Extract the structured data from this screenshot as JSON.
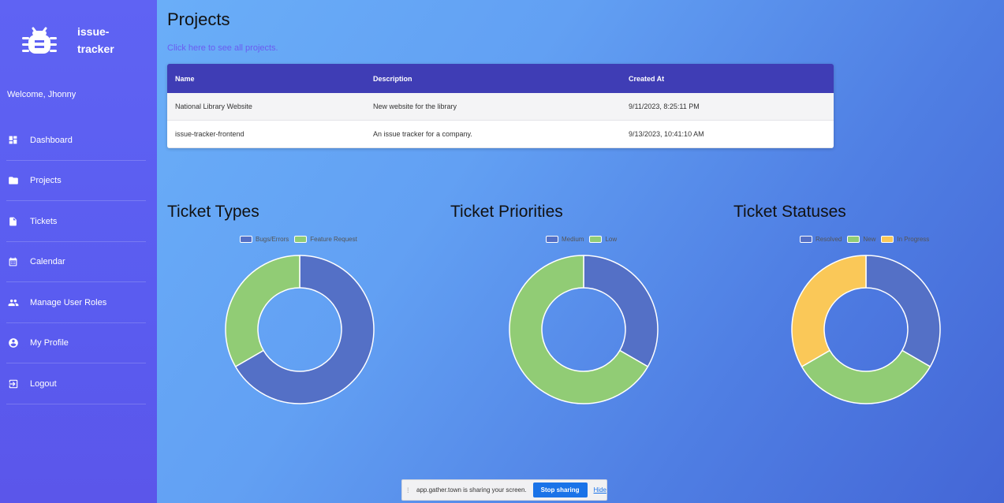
{
  "app": {
    "name": "issue-tracker",
    "name_line1": "issue-",
    "name_line2": "tracker"
  },
  "sidebar": {
    "welcome": "Welcome, Jhonny",
    "items": [
      {
        "label": "Dashboard",
        "icon": "dashboard-icon"
      },
      {
        "label": "Projects",
        "icon": "folder-icon"
      },
      {
        "label": "Tickets",
        "icon": "file-icon"
      },
      {
        "label": "Calendar",
        "icon": "calendar-icon"
      },
      {
        "label": "Manage User Roles",
        "icon": "group-icon"
      },
      {
        "label": "My Profile",
        "icon": "account-circle-icon"
      },
      {
        "label": "Logout",
        "icon": "logout-icon"
      }
    ]
  },
  "main": {
    "title": "Projects",
    "see_all_link": "Click here to see all projects.",
    "table": {
      "headers": [
        "Name",
        "Description",
        "Created At"
      ],
      "rows": [
        [
          "National Library Website",
          "New website for the library",
          "9/11/2023, 8:25:11 PM"
        ],
        [
          "issue-tracker-frontend",
          "An issue tracker for a company.",
          "9/13/2023, 10:41:10 AM"
        ]
      ]
    }
  },
  "chart_data": [
    {
      "type": "pie",
      "title": "Ticket Types",
      "categories": [
        "Bugs/Errors",
        "Feature Request"
      ],
      "values": [
        2,
        1
      ],
      "colors": [
        "#5470c6",
        "#91cc75"
      ]
    },
    {
      "type": "pie",
      "title": "Ticket Priorities",
      "categories": [
        "Medium",
        "Low"
      ],
      "values": [
        1,
        2
      ],
      "colors": [
        "#5470c6",
        "#91cc75"
      ]
    },
    {
      "type": "pie",
      "title": "Ticket Statuses",
      "categories": [
        "Resolved",
        "New",
        "In Progress"
      ],
      "values": [
        1,
        1,
        1
      ],
      "colors": [
        "#5470c6",
        "#91cc75",
        "#fac858"
      ]
    }
  ],
  "share_bar": {
    "message": "app.gather.town is sharing your screen.",
    "stop_label": "Stop sharing",
    "hide_label": "Hide"
  }
}
